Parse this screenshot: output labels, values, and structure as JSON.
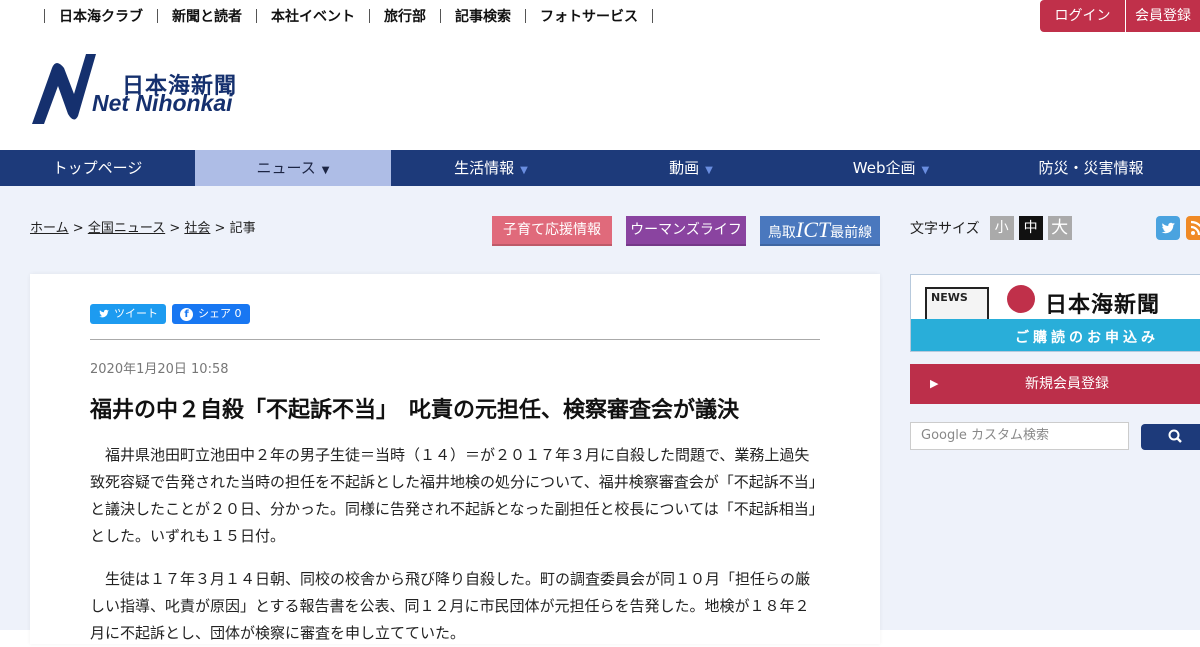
{
  "topnav": [
    "日本海クラブ",
    "新聞と読者",
    "本社イベント",
    "旅行部",
    "記事検索",
    "フォトサービス"
  ],
  "auth": {
    "login": "ログイン",
    "register": "会員登録"
  },
  "logo": {
    "name": "日本海新聞",
    "sub": "Net Nihonkai",
    "letter": "N"
  },
  "mainnav": [
    "トップページ",
    "ニュース",
    "生活情報",
    "動画",
    "Web企画",
    "防災・災害情報"
  ],
  "breadcrumb": {
    "home": "ホーム",
    "national": "全国ニュース",
    "society": "社会",
    "current": "記事",
    "sep": ">"
  },
  "banners": {
    "kids": "子育て応援情報",
    "women": "ウーマンズライフ",
    "ict_pre": "鳥取",
    "ict_big": "ICT",
    "ict_post": "最前線"
  },
  "fontsize": {
    "label": "文字サイズ",
    "small": "小",
    "medium": "中",
    "large": "大"
  },
  "share": {
    "tweet": "ツイート",
    "fb": "シェア",
    "fb_count": "0"
  },
  "article": {
    "date": "2020年1月20日 10:58",
    "title": "福井の中２自殺「不起訴不当」　叱責の元担任、検察審査会が議決",
    "p1": "福井県池田町立池田中２年の男子生徒＝当時（１４）＝が２０１７年３月に自殺した問題で、業務上過失致死容疑で告発された当時の担任を不起訴とした福井地検の処分について、福井検察審査会が「不起訴不当」と議決したことが２０日、分かった。同様に告発され不起訴となった副担任と校長については「不起訴相当」とした。いずれも１５日付。",
    "p2": "生徒は１７年３月１４日朝、同校の校舎から飛び降り自殺した。町の調査委員会が同１０月「担任らの厳しい指導、叱責が原因」とする報告書を公表、同１２月に市民団体が元担任らを告発した。地検が１８年２月に不起訴とし、団体が検察に審査を申し立てていた。"
  },
  "sidebar": {
    "news_label": "NEWS",
    "paper_name": "日本海新聞",
    "subscribe": "ご購読のお申込み",
    "new_member": "新規会員登録",
    "search_placeholder": "Google カスタム検索"
  },
  "colors": {
    "nav": "#1d3a7a",
    "accent": "#c0304a",
    "active_tab": "#aebde6"
  }
}
